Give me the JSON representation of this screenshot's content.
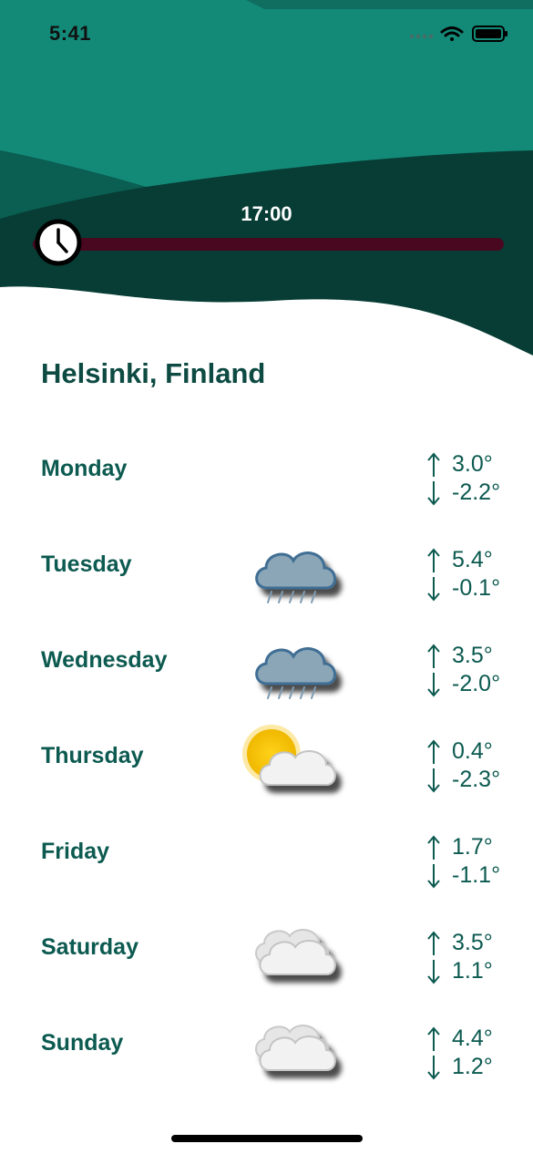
{
  "status_bar": {
    "time": "5:41"
  },
  "slider": {
    "time_label": "17:00",
    "position": 0.0
  },
  "location": {
    "name": "Helsinki, Finland"
  },
  "colors": {
    "header_light": "#138a78",
    "header_mid": "#0a5e52",
    "header_dark": "#073d35",
    "track": "#4a0820",
    "text": "#0c5a50"
  },
  "forecast": [
    {
      "day": "Monday",
      "icon": "none",
      "high": "3.0°",
      "low": "-2.2°"
    },
    {
      "day": "Tuesday",
      "icon": "rain-icon",
      "high": "5.4°",
      "low": "-0.1°"
    },
    {
      "day": "Wednesday",
      "icon": "rain-icon",
      "high": "3.5°",
      "low": "-2.0°"
    },
    {
      "day": "Thursday",
      "icon": "partly-sunny-icon",
      "high": "0.4°",
      "low": "-2.3°"
    },
    {
      "day": "Friday",
      "icon": "none",
      "high": "1.7°",
      "low": "-1.1°"
    },
    {
      "day": "Saturday",
      "icon": "cloudy-icon",
      "high": "3.5°",
      "low": "1.1°"
    },
    {
      "day": "Sunday",
      "icon": "cloudy-icon",
      "high": "4.4°",
      "low": "1.2°"
    }
  ]
}
